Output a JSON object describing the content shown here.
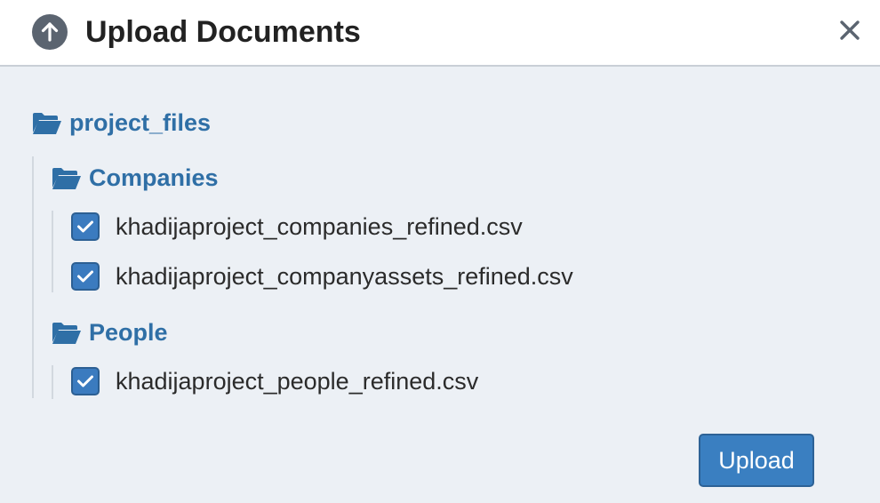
{
  "dialog": {
    "title": "Upload Documents",
    "icon": "upload-arrow-icon",
    "close_icon": "close-icon"
  },
  "tree": {
    "root": {
      "label": "project_files",
      "icon": "folder-open-icon"
    },
    "folders": [
      {
        "label": "Companies",
        "icon": "folder-open-icon",
        "files": [
          {
            "name": "khadijaproject_companies_refined.csv",
            "checked": true
          },
          {
            "name": "khadijaproject_companyassets_refined.csv",
            "checked": true
          }
        ]
      },
      {
        "label": "People",
        "icon": "folder-open-icon",
        "files": [
          {
            "name": "khadijaproject_people_refined.csv",
            "checked": true
          }
        ]
      }
    ]
  },
  "actions": {
    "upload_label": "Upload"
  },
  "colors": {
    "accent": "#3a7fc1",
    "folder_text": "#2f6fa6",
    "background": "#ecf0f5"
  }
}
